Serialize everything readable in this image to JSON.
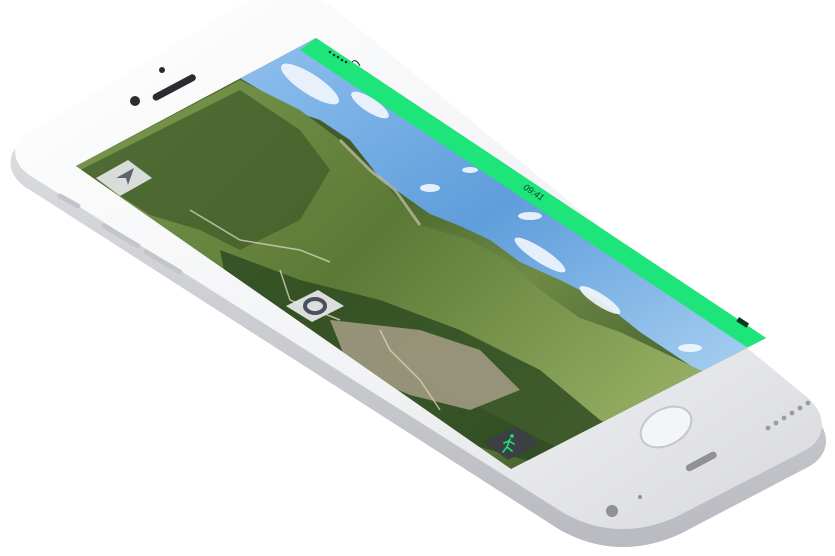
{
  "status_bar": {
    "time": "09:41",
    "color": "#1ee57a"
  },
  "map_controls": {
    "compass_icon": "navigation-arrow-icon",
    "location_icon": "target-ring-icon",
    "mode_icon": "hiker-icon"
  },
  "colors": {
    "phone_body": "#f4f4f6",
    "phone_edge": "#d9dade",
    "screen_bezel": "#ffffff",
    "sky": "#6fa7e0",
    "terrain_dark": "#2f4a22",
    "terrain_light": "#7f9a52",
    "control_bg": "#5c6470",
    "accent_green": "#1ee57a"
  }
}
